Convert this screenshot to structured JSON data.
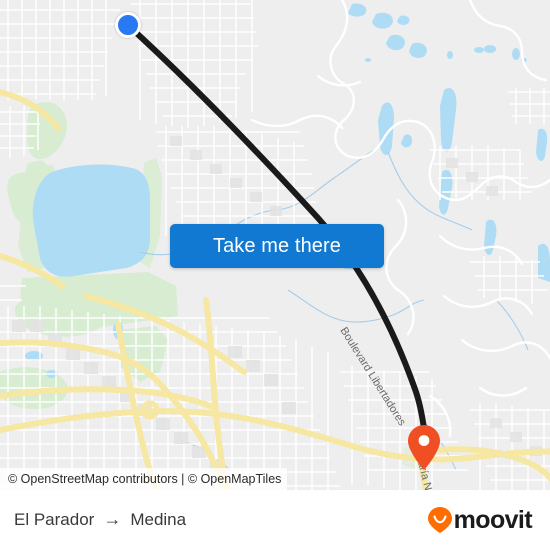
{
  "map": {
    "attribution": "© OpenStreetMap contributors | © OpenMapTiles",
    "road_labels": [
      {
        "name": "boulevard-libertadores",
        "text": "Boulevard Libertadores"
      },
      {
        "name": "calle-maria-n",
        "text": "aría N"
      }
    ],
    "markers": {
      "origin": {
        "name": "origin-marker",
        "color": "#2979f2"
      },
      "destination": {
        "name": "destination-marker",
        "color": "#f04e23"
      }
    },
    "route": {
      "color": "#1a1a1a"
    },
    "colors": {
      "land": "#eeeeee",
      "water": "#aedcf5",
      "park": "#d5eccd",
      "road_arterial": "#f7e9a8",
      "road_minor": "#ffffff",
      "building": "#e4e4e4"
    }
  },
  "cta": {
    "label": "Take me there",
    "color": "#1179d1"
  },
  "footer": {
    "origin": "El Parador",
    "arrow": "→",
    "destination": "Medina",
    "brand": "moovit",
    "brand_color": "#ff6c00"
  }
}
